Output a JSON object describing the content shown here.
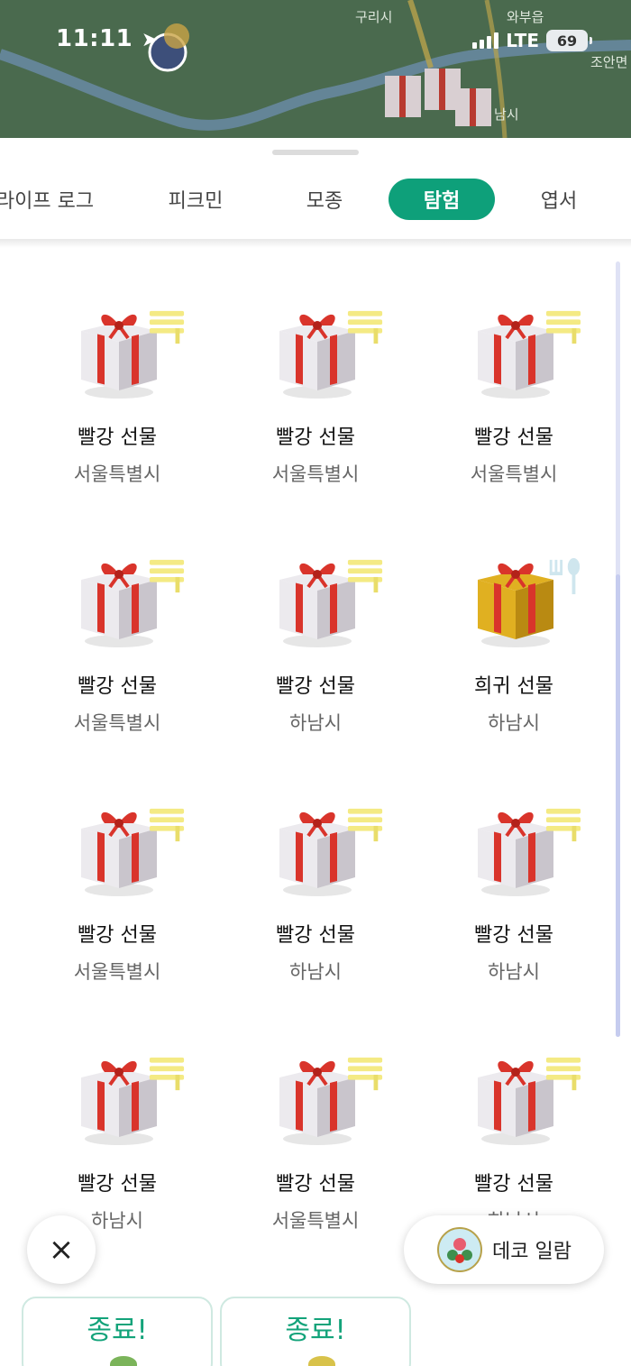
{
  "status_bar": {
    "time": "11:11",
    "network": "LTE",
    "battery": "69"
  },
  "map": {
    "places": [
      "구리시",
      "와부읍",
      "조안면",
      "남시"
    ]
  },
  "tabs": [
    {
      "label": "라이프 로그",
      "active": false
    },
    {
      "label": "피크민",
      "active": false
    },
    {
      "label": "모종",
      "active": false
    },
    {
      "label": "탐험",
      "active": true
    },
    {
      "label": "엽서",
      "active": false
    }
  ],
  "items": [
    {
      "name": "빨강 선물",
      "location": "서울특별시",
      "gift": "white",
      "badge": "bench-icon"
    },
    {
      "name": "빨강 선물",
      "location": "서울특별시",
      "gift": "white",
      "badge": "bench-icon"
    },
    {
      "name": "빨강 선물",
      "location": "서울특별시",
      "gift": "white",
      "badge": "bench-icon"
    },
    {
      "name": "빨강 선물",
      "location": "서울특별시",
      "gift": "white",
      "badge": "bench-icon"
    },
    {
      "name": "빨강 선물",
      "location": "하남시",
      "gift": "white",
      "badge": "bench-icon"
    },
    {
      "name": "희귀 선물",
      "location": "하남시",
      "gift": "gold",
      "badge": "fork-spoon-icon"
    },
    {
      "name": "빨강 선물",
      "location": "서울특별시",
      "gift": "white",
      "badge": "bench-icon"
    },
    {
      "name": "빨강 선물",
      "location": "하남시",
      "gift": "white",
      "badge": "bench-icon"
    },
    {
      "name": "빨강 선물",
      "location": "하남시",
      "gift": "white",
      "badge": "bench-icon"
    },
    {
      "name": "빨강 선물",
      "location": "하남시",
      "gift": "white",
      "badge": "bench-icon"
    },
    {
      "name": "빨강 선물",
      "location": "서울특별시",
      "gift": "white",
      "badge": "bench-icon"
    },
    {
      "name": "빨강 선물",
      "location": "하남시",
      "gift": "white",
      "badge": "bench-icon"
    }
  ],
  "floating": {
    "close_icon": "×",
    "deco_label": "데코 일람"
  },
  "cards": [
    {
      "label": "종료!"
    },
    {
      "label": "종료!"
    }
  ],
  "colors": {
    "accent": "#0ea07a",
    "ribbon": "#d9342b",
    "gift_white": "#eceaee",
    "gift_gold": "#e0b021"
  }
}
